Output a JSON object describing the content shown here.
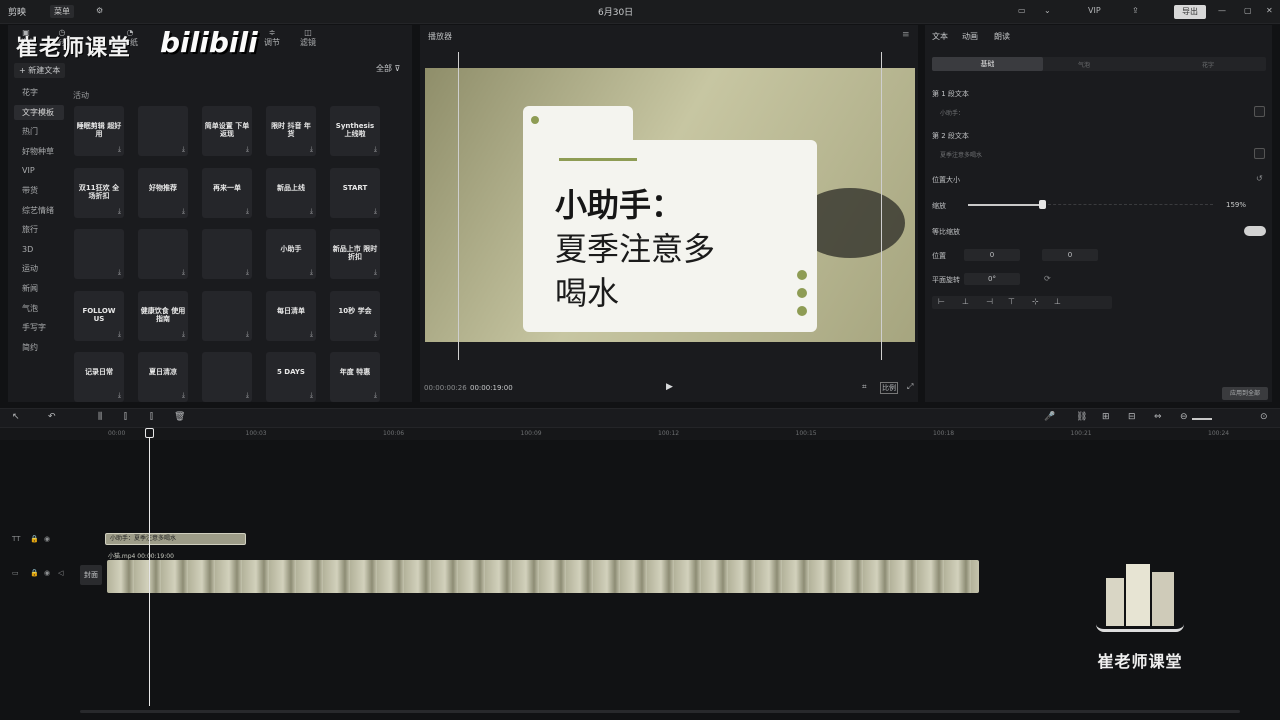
{
  "titlebar": {
    "app_name": "剪映",
    "menu_label": "菜单",
    "date": "6月30日",
    "export_label": "导出"
  },
  "left_panel": {
    "watermark": "崔老师课堂",
    "bili_logo": "bilibili",
    "top_tabs": [
      {
        "label": "媒体",
        "icon": "media-icon"
      },
      {
        "label": "音频",
        "icon": "audio-icon"
      },
      {
        "label": "文本",
        "icon": "text-icon"
      },
      {
        "label": "贴纸",
        "icon": "sticker-icon"
      },
      {
        "label": "特效",
        "icon": "effect-icon"
      },
      {
        "label": "转场",
        "icon": "transition-icon"
      },
      {
        "label": "滤镜",
        "icon": "filter-icon"
      },
      {
        "label": "调节",
        "icon": "adjust-icon"
      }
    ],
    "new_text_label": "+ 新建文本",
    "filter_label": "全部",
    "categories": [
      "花字",
      "文字模板",
      "热门",
      "好物种草",
      "VIP",
      "带货",
      "综艺情绪",
      "旅行",
      "3D",
      "运动",
      "新闻",
      "气泡",
      "手写字",
      "简约"
    ],
    "active_category_index": 1,
    "section_label": "活动",
    "tiles": [
      "睡眠剪辑 超好用",
      "",
      "简单设置 下单返现",
      "限时 抖音 年货",
      "Synthesis 上线啦",
      "双11狂欢 全场折扣",
      "好物推荐",
      "再来一单",
      "新品上线",
      "START",
      "",
      "",
      "",
      "小助手",
      "新品上市 限时折扣",
      "FOLLOW US",
      "健康饮食 使用指南",
      "",
      "每日清单",
      "10秒 学会",
      "记录日常",
      "夏日清凉",
      "",
      "5 DAYS",
      "年度 特惠"
    ]
  },
  "player": {
    "title": "播放器",
    "card_line1": "小助手：",
    "card_line2": "夏季注意多",
    "card_line3": "喝水",
    "current_time": "00:00:00:26",
    "duration": "00:00:19:00",
    "ratio_label": "比例",
    "fullscreen_icon": "fullscreen-icon"
  },
  "right_panel": {
    "tabs": [
      "文本",
      "动画",
      "朗读"
    ],
    "subtabs": [
      "基础",
      "气泡",
      "花字"
    ],
    "para1_label": "第 1 段文本",
    "para1_value": "小助手：",
    "para2_label": "第 2 段文本",
    "para2_value": "夏季注意多喝水",
    "position_size_label": "位置大小",
    "scale_label": "缩放",
    "scale_value": "159%",
    "scale_fraction": 0.46,
    "uniform_scale_label": "等比缩放",
    "position_label": "位置",
    "pos_x": "0",
    "pos_y": "0",
    "rotate_label": "平面旋转",
    "rotate_value": "0°",
    "apply_label": "应用到全部"
  },
  "timeline": {
    "ticks": [
      "00:00",
      "100:03",
      "100:06",
      "100:09",
      "100:12",
      "100:15",
      "100:18",
      "100:21",
      "100:24"
    ],
    "text_clip_label": "小助手：夏季注意多喝水",
    "video_clip_label": "小猫.mp4  00:00:19:00",
    "cover_label": "封面"
  },
  "brand": {
    "name": "崔老师课堂"
  },
  "colors": {
    "accent": "#8e9c54",
    "card_bg": "#f4f4ef",
    "panel_bg": "#1a1b1e"
  }
}
